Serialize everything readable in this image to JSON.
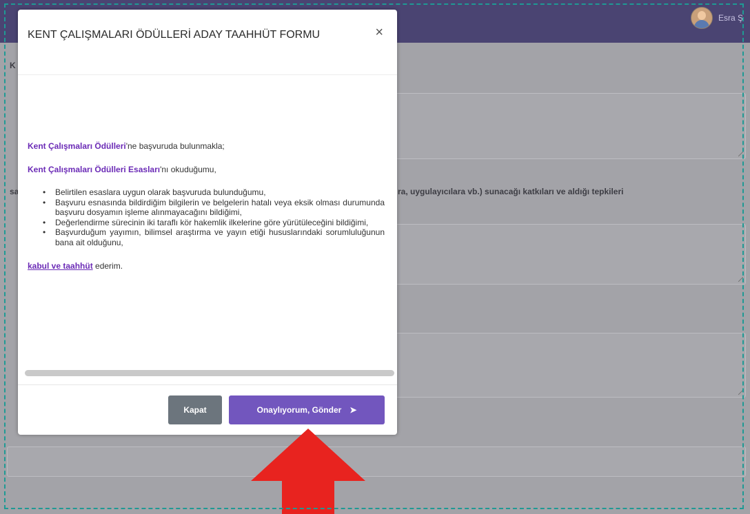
{
  "header": {
    "user_name": "Esra Ş",
    "avatar_icon": "user-avatar-icon"
  },
  "background": {
    "label_top": "K",
    "label_side": "sa",
    "question_text": "ra, uygulayıcılara vb.) sunacağı katkıları ve aldığı tepkileri"
  },
  "modal": {
    "title": "KENT ÇALIŞMALARI ÖDÜLLERİ ADAY TAAHHÜT FORMU",
    "close_symbol": "×",
    "intro1_highlight": "Kent Çalışmaları Ödülleri",
    "intro1_rest": "'ne başvuruda bulunmakla;",
    "intro2_highlight": "Kent Çalışmaları Ödülleri Esasları",
    "intro2_rest": "'nı okuduğumu,",
    "items": [
      "Belirtilen esaslara uygun olarak başvuruda bulunduğumu,",
      "Başvuru esnasında bildirdiğim bilgilerin ve belgelerin hatalı veya eksik olması durumunda başvuru dosyamın işleme alınmayacağını bildiğimi,",
      "Değerlendirme sürecinin iki taraflı kör hakemlik ilkelerine göre yürütüleceğini bildiğimi,",
      "Başvurduğum yayımın, bilimsel araştırma ve yayın etiği hususlarındaki sorumluluğunun bana ait olduğunu,"
    ],
    "closing_link": "kabul ve taahhüt",
    "closing_rest": " ederim.",
    "buttons": {
      "close_label": "Kapat",
      "submit_label": "Onaylıyorum, Gönder",
      "submit_icon": "➤"
    }
  },
  "colors": {
    "accent": "#7256be",
    "highlight_text": "#6b2bb6",
    "header_bg": "#4a4472",
    "overlay_bg": "#a3a3a8",
    "arrow": "#e8231f",
    "frame": "#1f9a94"
  }
}
